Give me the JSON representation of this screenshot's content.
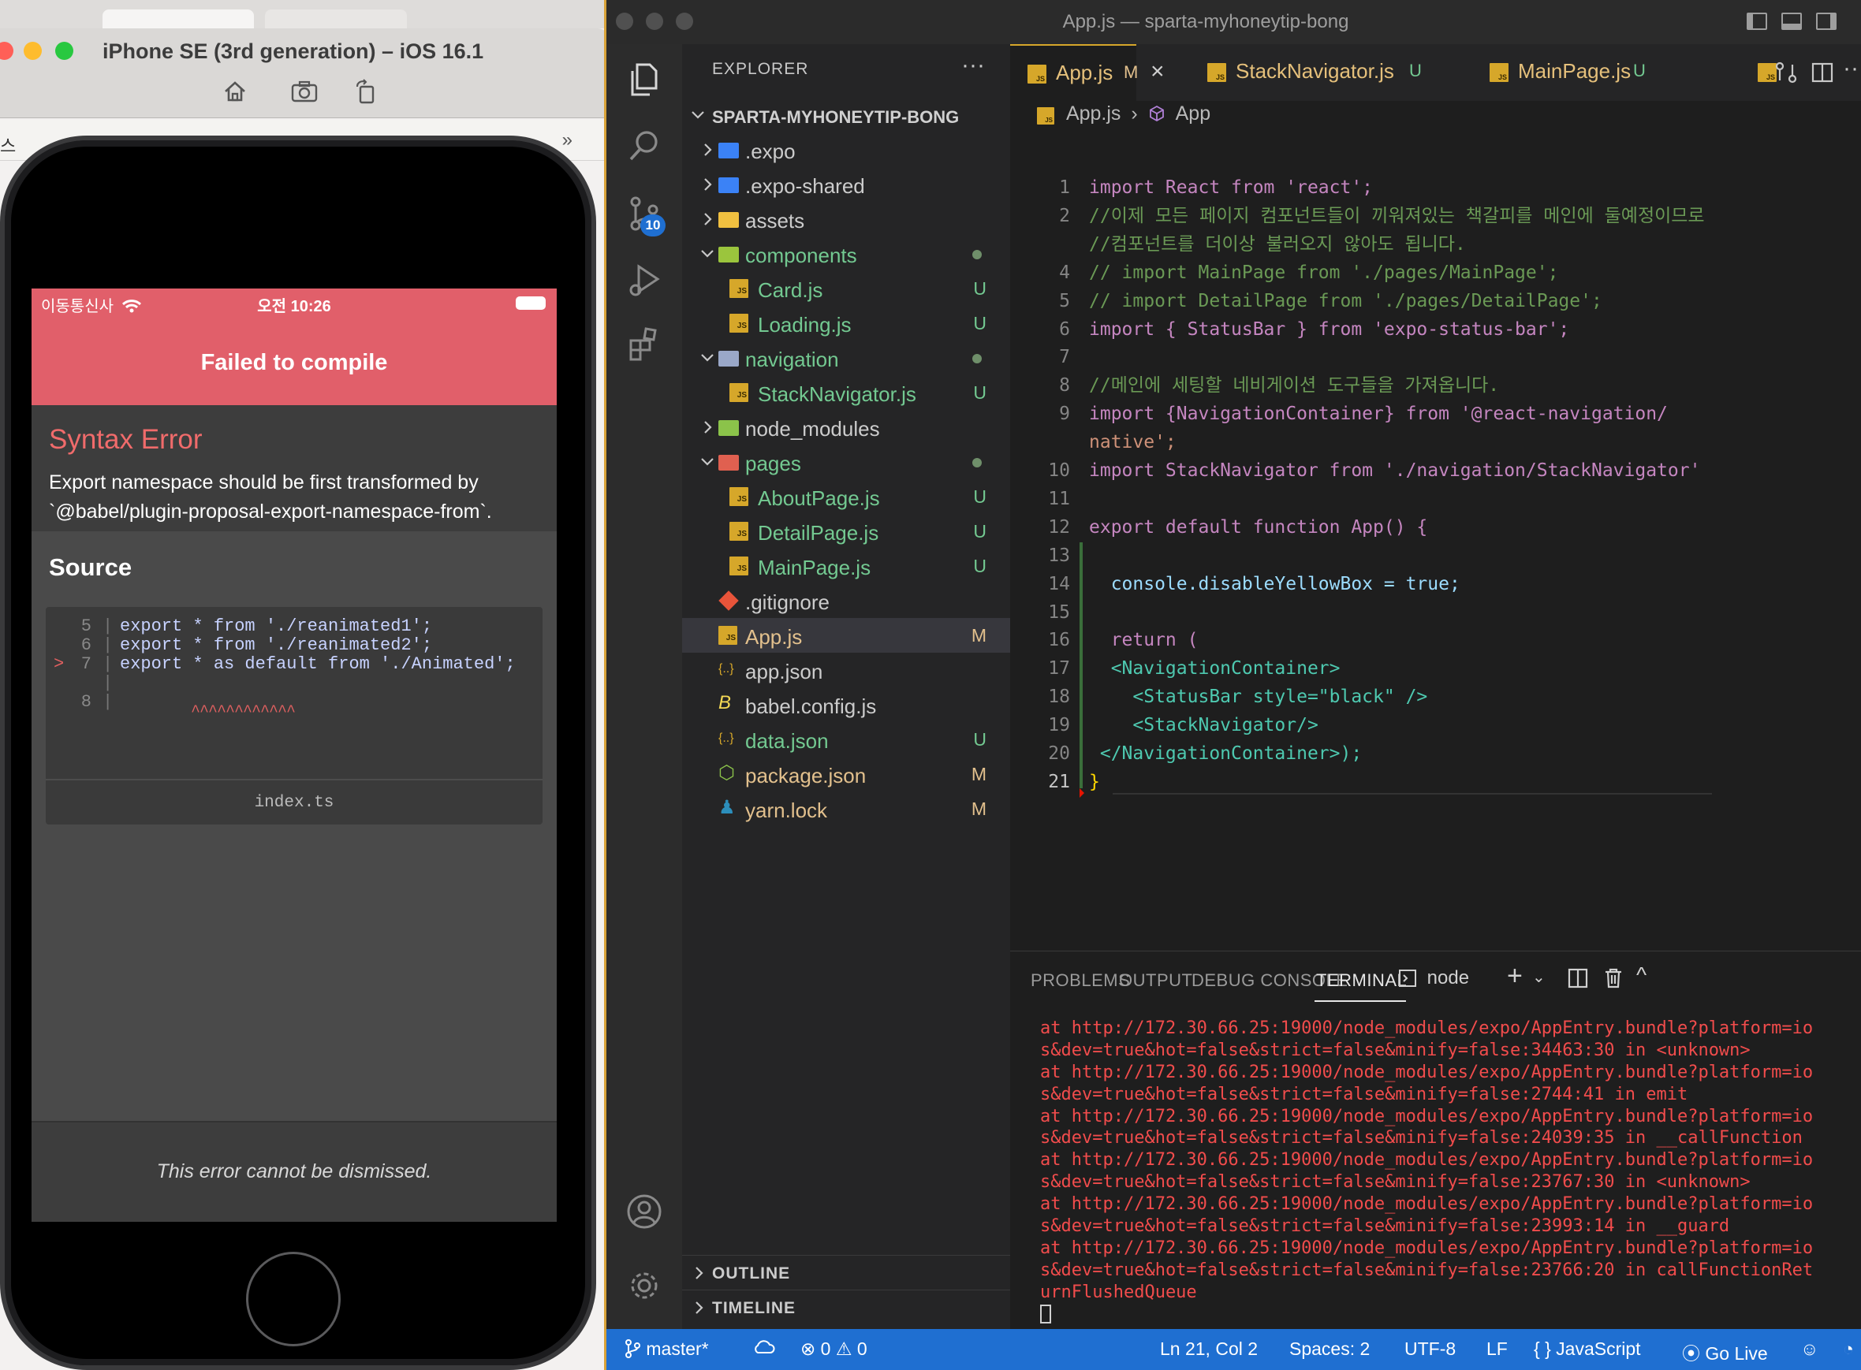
{
  "simulator": {
    "window_title": "iPhone SE (3rd generation) – iOS 16.1",
    "background_fragment": "스",
    "status": {
      "carrier": "이동통신사",
      "time": "오전 10:26"
    },
    "error_header": "Failed to compile",
    "error_type": "Syntax Error",
    "error_message": "Export namespace should be first transformed by `@babel/plugin-proposal-export-namespace-from`.",
    "source_title": "Source",
    "source_lines": [
      {
        "marker": "",
        "num": "5",
        "code": "export * from './reanimated1';"
      },
      {
        "marker": "",
        "num": "6",
        "code": "export * from './reanimated2';"
      },
      {
        "marker": ">",
        "num": "7",
        "code": "export * as default from './Animated';"
      },
      {
        "marker": "",
        "num": "",
        "code": ""
      },
      {
        "marker": "",
        "num": "8",
        "code": ""
      }
    ],
    "caret": "^^^^^^^^^^^^",
    "source_file": "index.ts",
    "dismiss_text": "This error cannot be dismissed."
  },
  "vscode": {
    "window_title": "App.js — sparta-myhoneytip-bong",
    "scm_badge": "10",
    "explorer": {
      "header": "EXPLORER",
      "root": "SPARTA-MYHONEYTIP-BONG",
      "items": [
        {
          "label": ".expo",
          "type": "folder",
          "status": ""
        },
        {
          "label": ".expo-shared",
          "type": "folder",
          "status": ""
        },
        {
          "label": "assets",
          "type": "folder",
          "status": ""
        },
        {
          "label": "components",
          "type": "folder-open",
          "status": "dot"
        },
        {
          "label": "Card.js",
          "type": "js",
          "status": "U"
        },
        {
          "label": "Loading.js",
          "type": "js",
          "status": "U"
        },
        {
          "label": "navigation",
          "type": "folder-open",
          "status": "dot"
        },
        {
          "label": "StackNavigator.js",
          "type": "js",
          "status": "U"
        },
        {
          "label": "node_modules",
          "type": "folder",
          "status": ""
        },
        {
          "label": "pages",
          "type": "folder-open",
          "status": "dot"
        },
        {
          "label": "AboutPage.js",
          "type": "js",
          "status": "U"
        },
        {
          "label": "DetailPage.js",
          "type": "js",
          "status": "U"
        },
        {
          "label": "MainPage.js",
          "type": "js",
          "status": "U"
        },
        {
          "label": ".gitignore",
          "type": "git",
          "status": ""
        },
        {
          "label": "App.js",
          "type": "js",
          "status": "M"
        },
        {
          "label": "app.json",
          "type": "json",
          "status": ""
        },
        {
          "label": "babel.config.js",
          "type": "babel",
          "status": ""
        },
        {
          "label": "data.json",
          "type": "json",
          "status": "U"
        },
        {
          "label": "package.json",
          "type": "npm",
          "status": "M"
        },
        {
          "label": "yarn.lock",
          "type": "yarn",
          "status": "M"
        }
      ],
      "outline": "OUTLINE",
      "timeline": "TIMELINE"
    },
    "tabs": [
      {
        "label": "App.js",
        "status": "M"
      },
      {
        "label": "StackNavigator.js",
        "status": "U"
      },
      {
        "label": "MainPage.js",
        "status": "U"
      }
    ],
    "breadcrumb": {
      "file": "App.js",
      "symbol": "App"
    },
    "code_lines": [
      {
        "num": "1",
        "text": "import React from 'react';"
      },
      {
        "num": "2",
        "text": "//이제 모든 페이지 컴포넌트들이 끼워져있는 책갈피를 메인에 둘예정이므로"
      },
      {
        "num": "",
        "text": "//컴포넌트를 더이상 불러오지 않아도 됩니다."
      },
      {
        "num": "4",
        "text": "// import MainPage from './pages/MainPage';"
      },
      {
        "num": "5",
        "text": "// import DetailPage from './pages/DetailPage';"
      },
      {
        "num": "6",
        "text": "import { StatusBar } from 'expo-status-bar';"
      },
      {
        "num": "7",
        "text": ""
      },
      {
        "num": "8",
        "text": "//메인에 세팅할 네비게이션 도구들을 가져옵니다."
      },
      {
        "num": "9",
        "text": "import {NavigationContainer} from '@react-navigation/"
      },
      {
        "num": "",
        "text": "native';"
      },
      {
        "num": "10",
        "text": "import StackNavigator from './navigation/StackNavigator'"
      },
      {
        "num": "11",
        "text": ""
      },
      {
        "num": "12",
        "text": "export default function App() {"
      },
      {
        "num": "13",
        "text": ""
      },
      {
        "num": "14",
        "text": "  console.disableYellowBox = true;"
      },
      {
        "num": "15",
        "text": ""
      },
      {
        "num": "16",
        "text": "  return ("
      },
      {
        "num": "17",
        "text": "  <NavigationContainer>"
      },
      {
        "num": "18",
        "text": "    <StatusBar style=\"black\" />"
      },
      {
        "num": "19",
        "text": "    <StackNavigator/>"
      },
      {
        "num": "20",
        "text": " </NavigationContainer>);"
      },
      {
        "num": "21",
        "text": "}"
      }
    ],
    "panel": {
      "tabs": [
        "PROBLEMS",
        "OUTPUT",
        "DEBUG CONSOLE",
        "TERMINAL"
      ],
      "shell": "node",
      "terminal_lines": [
        "at http://172.30.66.25:19000/node_modules/expo/AppEntry.bundle?platform=io",
        "s&dev=true&hot=false&strict=false&minify=false:34463:30 in <unknown>",
        "at http://172.30.66.25:19000/node_modules/expo/AppEntry.bundle?platform=io",
        "s&dev=true&hot=false&strict=false&minify=false:2744:41 in emit",
        "at http://172.30.66.25:19000/node_modules/expo/AppEntry.bundle?platform=io",
        "s&dev=true&hot=false&strict=false&minify=false:24039:35 in __callFunction",
        "at http://172.30.66.25:19000/node_modules/expo/AppEntry.bundle?platform=io",
        "s&dev=true&hot=false&strict=false&minify=false:23767:30 in <unknown>",
        "at http://172.30.66.25:19000/node_modules/expo/AppEntry.bundle?platform=io",
        "s&dev=true&hot=false&strict=false&minify=false:23993:14 in __guard",
        "at http://172.30.66.25:19000/node_modules/expo/AppEntry.bundle?platform=io",
        "s&dev=true&hot=false&strict=false&minify=false:23766:20 in callFunctionRet",
        "urnFlushedQueue"
      ]
    },
    "statusbar": {
      "branch": "master*",
      "errors": "0",
      "warnings": "0",
      "cursor": "Ln 21, Col 2",
      "spaces": "Spaces: 2",
      "encoding": "UTF-8",
      "eol": "LF",
      "language": "JavaScript",
      "golive": "Go Live"
    }
  }
}
